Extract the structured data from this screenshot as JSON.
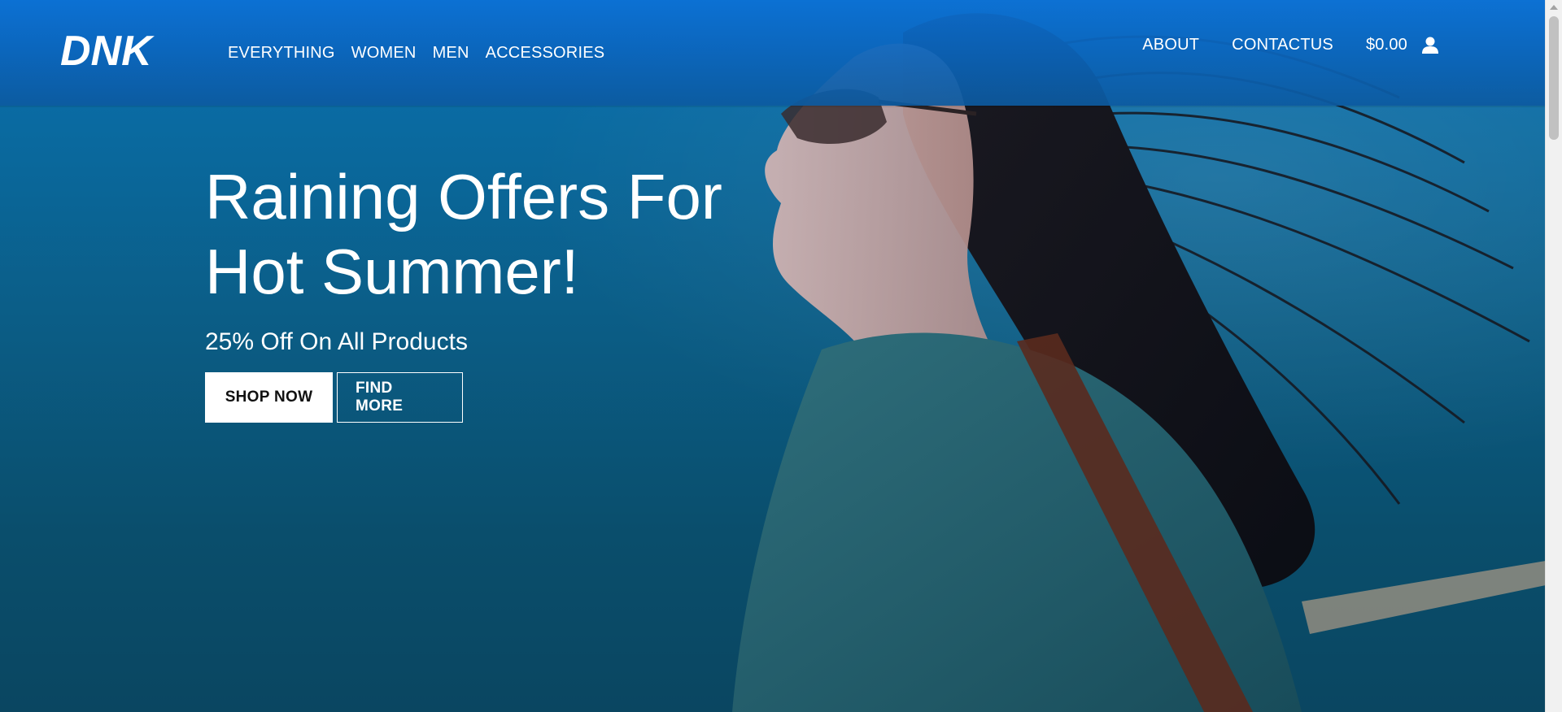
{
  "brand": {
    "logo_text": "DNK"
  },
  "nav": {
    "left_items": [
      {
        "label": "EVERYTHING"
      },
      {
        "label": "WOMEN"
      },
      {
        "label": "MEN"
      },
      {
        "label": "ACCESSORIES"
      }
    ],
    "right_items": [
      {
        "label": "ABOUT"
      },
      {
        "label": "CONTACTUS"
      }
    ],
    "cart_total": "$0.00",
    "user_icon": "user-icon"
  },
  "hero": {
    "title_line1": "Raining Offers For",
    "title_line2": "Hot Summer!",
    "subtitle": "25% Off On All Products",
    "primary_button": "SHOP NOW",
    "secondary_button": "FIND MORE"
  },
  "colors": {
    "header_top": "#0c71d6",
    "hero_dark": "#0a4661",
    "text": "#ffffff",
    "button_bg": "#ffffff",
    "button_text": "#111111"
  }
}
